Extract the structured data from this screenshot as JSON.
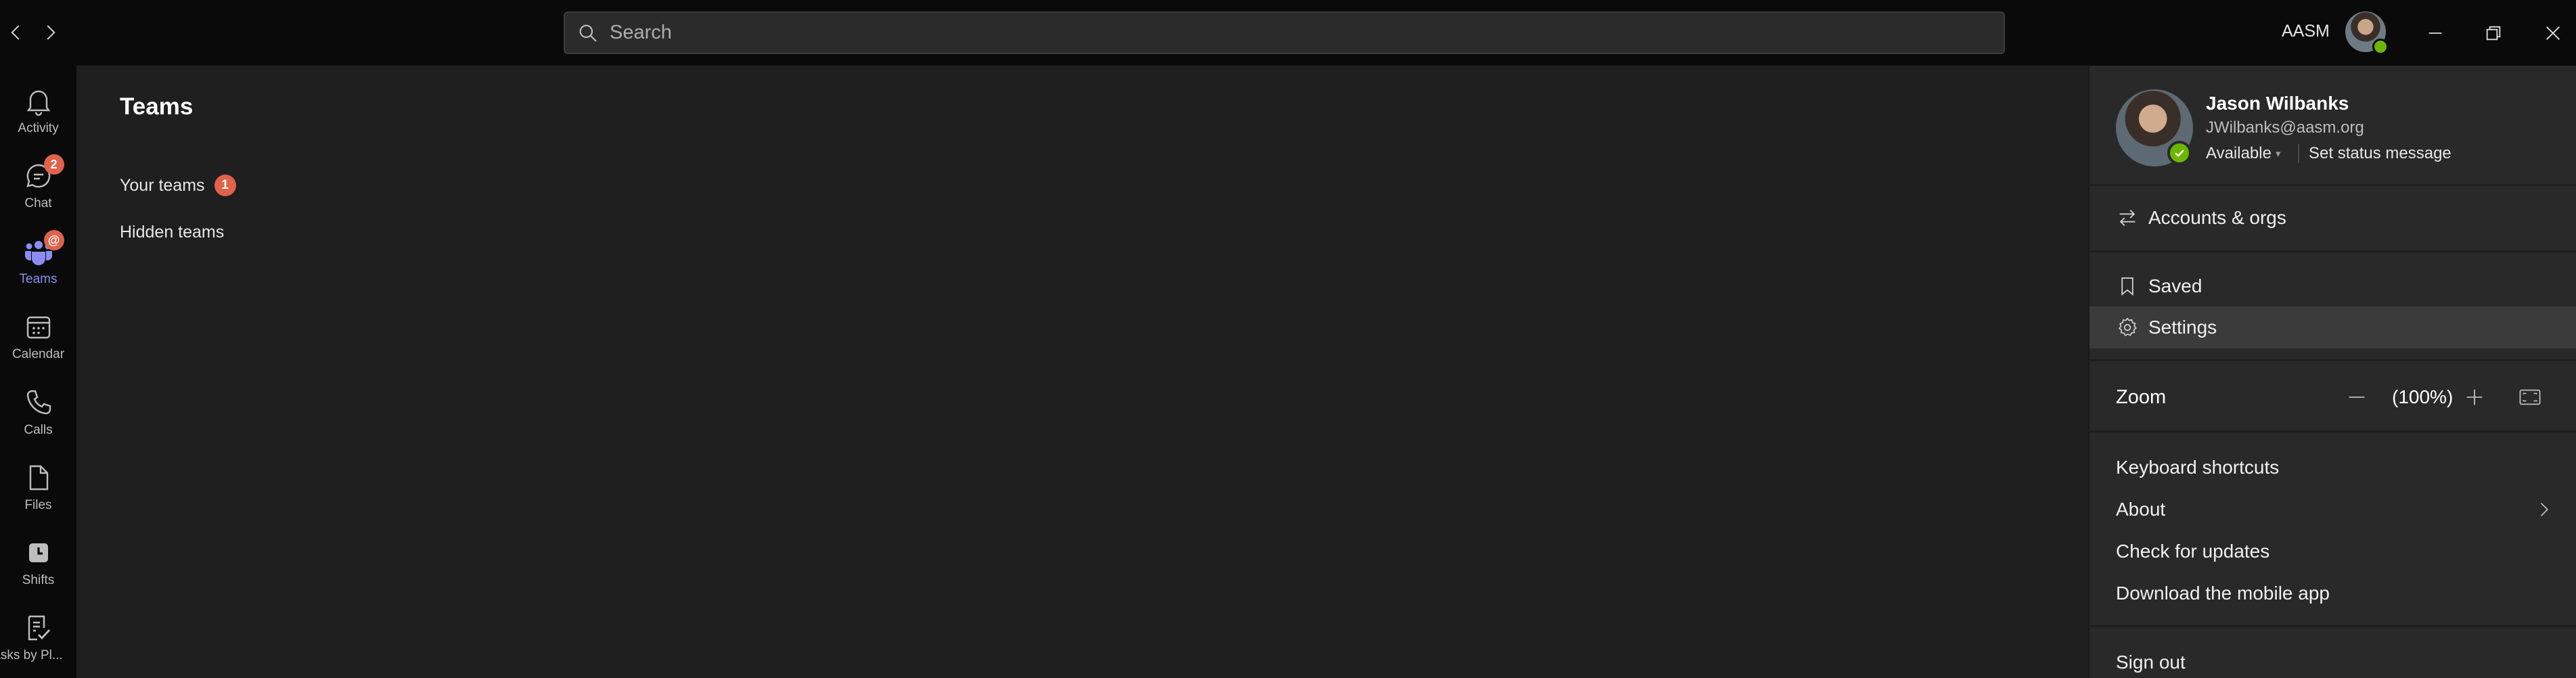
{
  "titlebar": {
    "search_placeholder": "Search",
    "org_label": "AASM"
  },
  "rail": {
    "items": [
      {
        "label": "Activity",
        "icon": "bell-icon"
      },
      {
        "label": "Chat",
        "icon": "chat-icon",
        "badge": "2"
      },
      {
        "label": "Teams",
        "icon": "teams-icon",
        "badge": "@",
        "active": true
      },
      {
        "label": "Calendar",
        "icon": "calendar-icon"
      },
      {
        "label": "Calls",
        "icon": "phone-icon"
      },
      {
        "label": "Files",
        "icon": "file-icon"
      },
      {
        "label": "Shifts",
        "icon": "clock-icon"
      },
      {
        "label": "asks by Pl...",
        "icon": "tasks-icon"
      }
    ]
  },
  "main": {
    "title": "Teams",
    "sections": [
      {
        "label": "Your teams",
        "badge": "1"
      },
      {
        "label": "Hidden teams"
      }
    ]
  },
  "profile": {
    "name": "Jason Wilbanks",
    "email": "JWilbanks@aasm.org",
    "status": "Available",
    "set_status": "Set status message",
    "presence_color": "#6bb700"
  },
  "menu": {
    "accounts": "Accounts & orgs",
    "saved": "Saved",
    "settings": "Settings",
    "zoom_label": "Zoom",
    "zoom_value": "(100%)",
    "keyboard_shortcuts": "Keyboard shortcuts",
    "about": "About",
    "check_updates": "Check for updates",
    "download_mobile": "Download the mobile app",
    "sign_out": "Sign out"
  },
  "colors": {
    "accent": "#8b8cf2",
    "badge": "#e0624a",
    "panel_bg": "#292929",
    "highlight_bg": "#3b3b3b"
  }
}
